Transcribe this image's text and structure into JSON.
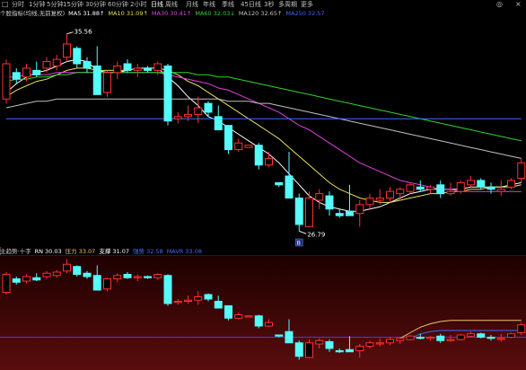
{
  "toolbar": {
    "periods": [
      {
        "label": "分时",
        "active": false
      },
      {
        "label": "1分钟",
        "active": false
      },
      {
        "label": "5分钟",
        "active": false
      },
      {
        "label": "15分钟",
        "active": false
      },
      {
        "label": "30分钟",
        "active": false
      },
      {
        "label": "60分钟",
        "active": false
      },
      {
        "label": "2小时",
        "active": false
      },
      {
        "label": "日线",
        "active": true
      },
      {
        "label": "周线",
        "active": false
      },
      {
        "label": "月线",
        "active": false
      },
      {
        "label": "年线",
        "active": false
      },
      {
        "label": "季线",
        "active": false
      },
      {
        "label": "45日线",
        "active": false
      },
      {
        "label": "3秒",
        "active": false
      },
      {
        "label": "多周期",
        "active": false
      },
      {
        "label": "更多",
        "active": false
      }
    ],
    "left_icon": "□",
    "settings_icon": "◎",
    "close_icon": "×"
  },
  "main_indicator": {
    "name": "个股指标(均线,无前复权)",
    "items": [
      {
        "label": "MA5 31.88↑",
        "color": "#ffffff"
      },
      {
        "label": "MA10 31.09↑",
        "color": "#e8e05a"
      },
      {
        "label": "MA30 30.41↑",
        "color": "#e040e0"
      },
      {
        "label": "MA60 32.03↓",
        "color": "#2fd32f"
      },
      {
        "label": "MA120 32.65↑",
        "color": "#c0c0c0"
      },
      {
        "label": "MA250 32.57",
        "color": "#3a6cff"
      }
    ]
  },
  "sub_indicator": {
    "name": "主趋势·十字",
    "items": [
      {
        "label": "RN 30.03",
        "color": "#ffffff"
      },
      {
        "label": "压力 33.07",
        "color": "#e8c870"
      },
      {
        "label": "支撑 31.07",
        "color": "#ffffff"
      },
      {
        "label": "强势 32.58",
        "color": "#3a6cff"
      },
      {
        "label": "MAVR 33.08",
        "color": "#3a6cff"
      }
    ]
  },
  "annotations": {
    "high_label": "35.56",
    "low_label": "26.79",
    "low_marker": "B"
  },
  "chart_data": {
    "type": "candlestick",
    "ohlc": [
      [
        32.6,
        34.4,
        32.4,
        34.2
      ],
      [
        33.8,
        34.0,
        33.3,
        33.5
      ],
      [
        33.6,
        34.2,
        33.4,
        34.0
      ],
      [
        33.9,
        34.3,
        33.6,
        33.7
      ],
      [
        34.0,
        34.5,
        33.8,
        34.3
      ],
      [
        34.1,
        34.6,
        33.9,
        34.4
      ],
      [
        34.5,
        35.56,
        34.3,
        35.1
      ],
      [
        34.9,
        35.0,
        34.0,
        34.2
      ],
      [
        34.3,
        34.5,
        33.8,
        34.0
      ],
      [
        34.1,
        35.0,
        33.0,
        32.8
      ],
      [
        32.9,
        33.9,
        32.7,
        33.8
      ],
      [
        33.8,
        34.3,
        33.5,
        34.1
      ],
      [
        34.2,
        34.4,
        33.8,
        33.9
      ],
      [
        33.9,
        34.2,
        33.6,
        34.0
      ],
      [
        34.0,
        34.1,
        33.8,
        33.9
      ],
      [
        33.9,
        34.3,
        33.7,
        34.2
      ],
      [
        34.1,
        34.2,
        31.4,
        31.6
      ],
      [
        31.7,
        32.0,
        31.5,
        31.8
      ],
      [
        31.8,
        32.3,
        31.6,
        31.9
      ],
      [
        31.9,
        32.7,
        31.5,
        32.2
      ],
      [
        32.4,
        32.5,
        31.8,
        32.0
      ],
      [
        31.8,
        32.3,
        31.7,
        31.2
      ],
      [
        31.4,
        31.4,
        30.1,
        30.3
      ],
      [
        30.3,
        30.8,
        30.2,
        30.6
      ],
      [
        30.4,
        30.5,
        30.4,
        30.5
      ],
      [
        30.5,
        30.6,
        29.4,
        29.6
      ],
      [
        29.6,
        30.2,
        29.5,
        29.9
      ],
      [
        28.8,
        28.8,
        28.6,
        28.7
      ],
      [
        29.1,
        30.2,
        29.0,
        28.1
      ],
      [
        28.1,
        28.3,
        26.6,
        26.9
      ],
      [
        26.8,
        28.4,
        26.79,
        28.1
      ],
      [
        28.0,
        28.5,
        27.6,
        28.3
      ],
      [
        28.2,
        28.4,
        27.3,
        27.6
      ],
      [
        27.4,
        27.6,
        27.2,
        27.3
      ],
      [
        27.5,
        28.7,
        27.3,
        27.3
      ],
      [
        27.4,
        28.0,
        26.8,
        27.8
      ],
      [
        27.8,
        28.3,
        27.6,
        28.1
      ],
      [
        28.0,
        28.5,
        27.8,
        28.1
      ],
      [
        28.1,
        28.6,
        27.9,
        28.4
      ],
      [
        28.3,
        28.6,
        28.0,
        28.5
      ],
      [
        28.4,
        28.8,
        28.3,
        28.7
      ],
      [
        28.6,
        28.9,
        28.4,
        28.5
      ],
      [
        28.5,
        28.7,
        28.3,
        28.6
      ],
      [
        28.7,
        28.9,
        28.1,
        28.3
      ],
      [
        28.3,
        28.8,
        28.2,
        28.4
      ],
      [
        28.4,
        28.9,
        28.3,
        28.8
      ],
      [
        28.7,
        29.1,
        28.6,
        28.9
      ],
      [
        28.9,
        29.0,
        28.5,
        28.6
      ],
      [
        28.6,
        28.8,
        28.3,
        28.5
      ],
      [
        28.4,
        28.9,
        28.2,
        28.5
      ],
      [
        28.6,
        29.0,
        28.5,
        28.9
      ],
      [
        29.0,
        29.9,
        28.8,
        29.7
      ]
    ],
    "ma": [
      {
        "name": "MA5",
        "color": "#ffffff",
        "values": [
          32.9,
          33.3,
          33.6,
          33.8,
          33.9,
          34.1,
          34.3,
          34.4,
          34.3,
          33.9,
          33.8,
          33.8,
          33.9,
          34.0,
          34.0,
          34.0,
          33.6,
          33.2,
          32.7,
          32.3,
          31.8,
          31.6,
          31.3,
          31.0,
          30.7,
          30.4,
          30.1,
          29.7,
          29.2,
          28.7,
          28.2,
          27.9,
          27.7,
          27.6,
          27.5,
          27.5,
          27.6,
          27.7,
          27.9,
          28.1,
          28.3,
          28.4,
          28.5,
          28.5,
          28.5,
          28.5,
          28.6,
          28.6,
          28.6,
          28.6,
          28.7,
          28.8
        ]
      },
      {
        "name": "MA10",
        "color": "#e8e05a",
        "values": [
          32.7,
          33.0,
          33.2,
          33.4,
          33.5,
          33.7,
          33.9,
          34.0,
          34.0,
          33.9,
          33.9,
          33.9,
          33.9,
          34.0,
          34.0,
          34.0,
          33.9,
          33.7,
          33.4,
          33.2,
          32.9,
          32.6,
          32.3,
          32.0,
          31.7,
          31.4,
          31.1,
          30.8,
          30.4,
          30.0,
          29.6,
          29.2,
          28.8,
          28.5,
          28.3,
          28.1,
          28.0,
          27.9,
          27.9,
          28.0,
          28.1,
          28.2,
          28.3,
          28.3,
          28.4,
          28.4,
          28.5,
          28.5,
          28.6,
          28.6,
          28.6,
          28.7
        ]
      },
      {
        "name": "MA30",
        "color": "#e040e0",
        "values": [
          33.6,
          33.6,
          33.7,
          33.7,
          33.7,
          33.8,
          33.8,
          33.8,
          33.8,
          33.8,
          33.8,
          33.8,
          33.8,
          33.8,
          33.8,
          33.8,
          33.7,
          33.6,
          33.5,
          33.4,
          33.3,
          33.1,
          33.0,
          32.8,
          32.6,
          32.4,
          32.2,
          32.0,
          31.7,
          31.4,
          31.2,
          30.9,
          30.6,
          30.3,
          30.0,
          29.7,
          29.5,
          29.3,
          29.1,
          28.9,
          28.8,
          28.7,
          28.6,
          28.5,
          28.5,
          28.4,
          28.4,
          28.4,
          28.4,
          28.4,
          28.4,
          28.4
        ]
      },
      {
        "name": "MA60",
        "color": "#2fd32f",
        "values": [
          33.4,
          33.5,
          33.5,
          33.6,
          33.6,
          33.7,
          33.7,
          33.8,
          33.8,
          33.8,
          33.8,
          33.8,
          33.8,
          33.8,
          33.8,
          33.8,
          33.8,
          33.8,
          33.8,
          33.7,
          33.7,
          33.6,
          33.6,
          33.5,
          33.4,
          33.3,
          33.2,
          33.1,
          33.0,
          32.9,
          32.8,
          32.7,
          32.6,
          32.5,
          32.4,
          32.3,
          32.2,
          32.1,
          32.0,
          31.9,
          31.8,
          31.7,
          31.6,
          31.5,
          31.4,
          31.3,
          31.2,
          31.1,
          31.0,
          30.9,
          30.8,
          30.7
        ]
      },
      {
        "name": "MA120",
        "color": "#c0c0c0",
        "values": [
          32.2,
          32.3,
          32.4,
          32.5,
          32.5,
          32.6,
          32.6,
          32.6,
          32.6,
          32.6,
          32.6,
          32.6,
          32.6,
          32.6,
          32.6,
          32.6,
          32.6,
          32.6,
          32.6,
          32.6,
          32.6,
          32.6,
          32.5,
          32.5,
          32.5,
          32.4,
          32.4,
          32.3,
          32.2,
          32.1,
          32.0,
          31.9,
          31.8,
          31.7,
          31.6,
          31.5,
          31.4,
          31.3,
          31.2,
          31.1,
          31.0,
          30.9,
          30.8,
          30.7,
          30.6,
          30.5,
          30.4,
          30.3,
          30.2,
          30.1,
          30.0,
          29.9
        ]
      },
      {
        "name": "MA250",
        "color": "#3a6cff",
        "values": [
          31.7,
          31.7,
          31.7,
          31.7,
          31.7,
          31.7,
          31.7,
          31.7,
          31.7,
          31.7,
          31.7,
          31.7,
          31.7,
          31.7,
          31.7,
          31.7,
          31.7,
          31.7,
          31.7,
          31.7,
          31.7,
          31.7,
          31.7,
          31.7,
          31.7,
          31.7,
          31.7,
          31.7,
          31.7,
          31.7,
          31.7,
          31.7,
          31.7,
          31.7,
          31.7,
          31.7,
          31.7,
          31.7,
          31.7,
          31.7,
          31.7,
          31.7,
          31.7,
          31.7,
          31.7,
          31.7,
          31.7,
          31.7,
          31.7,
          31.7,
          31.7,
          31.7
        ]
      }
    ],
    "ylim": [
      26.0,
      36.2
    ],
    "sub_lines": [
      {
        "name": "压力",
        "color": "#e8c870",
        "values": [
          null,
          null,
          null,
          null,
          null,
          null,
          null,
          null,
          null,
          null,
          null,
          null,
          null,
          null,
          null,
          null,
          null,
          null,
          null,
          null,
          null,
          null,
          null,
          null,
          null,
          null,
          null,
          null,
          null,
          null,
          null,
          null,
          null,
          null,
          null,
          null,
          null,
          null,
          null,
          28.5,
          29.0,
          29.5,
          29.8,
          30.0,
          30.1,
          30.1,
          30.1,
          30.1,
          30.1,
          30.1,
          30.1,
          30.1
        ]
      },
      {
        "name": "强势",
        "color": "#3a6cff",
        "values": [
          null,
          null,
          null,
          null,
          null,
          null,
          null,
          null,
          null,
          null,
          null,
          null,
          null,
          null,
          null,
          null,
          null,
          null,
          null,
          null,
          null,
          null,
          null,
          null,
          null,
          null,
          null,
          null,
          null,
          null,
          null,
          null,
          null,
          null,
          null,
          null,
          null,
          null,
          null,
          null,
          28.5,
          28.9,
          29.1,
          29.2,
          29.2,
          29.2,
          29.2,
          29.2,
          29.2,
          29.2,
          29.2,
          29.2
        ]
      }
    ],
    "sub_baseline": 28.6,
    "sub_ylim": [
      26.0,
      35.6
    ]
  }
}
